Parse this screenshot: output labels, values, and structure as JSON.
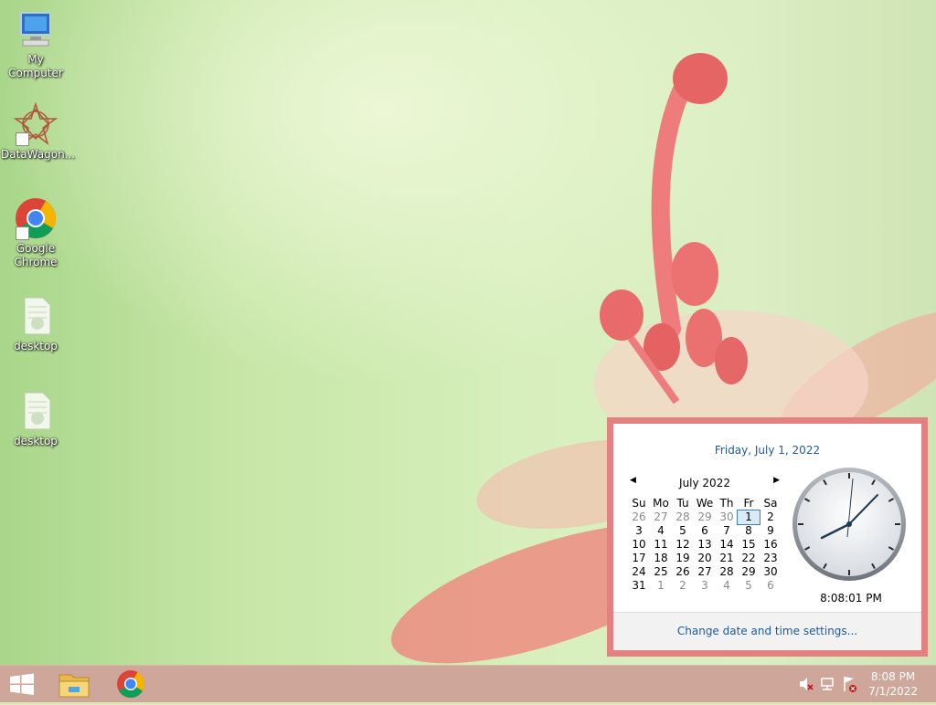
{
  "desktop": {
    "icons": [
      {
        "label": "My Computer",
        "icon": "my-computer-icon"
      },
      {
        "label": "DataWagon...",
        "icon": "datawagon-icon"
      },
      {
        "label": "Google Chrome",
        "icon": "chrome-icon"
      },
      {
        "label": "desktop",
        "icon": "file-icon"
      },
      {
        "label": "desktop",
        "icon": "file-icon"
      }
    ]
  },
  "taskbar": {
    "pinned": [
      {
        "name": "start-button",
        "icon": "windows-logo-icon"
      },
      {
        "name": "file-explorer",
        "icon": "folder-icon"
      },
      {
        "name": "google-chrome",
        "icon": "chrome-icon"
      }
    ],
    "tray_icons": [
      "volume-muted-icon",
      "network-icon",
      "action-center-flag-icon"
    ],
    "clock": {
      "time": "8:08 PM",
      "date": "7/1/2022"
    }
  },
  "calendar_popup": {
    "long_date": "Friday, July 1, 2022",
    "month_title": "July 2022",
    "weekdays": [
      "Su",
      "Mo",
      "Tu",
      "We",
      "Th",
      "Fr",
      "Sa"
    ],
    "weeks": [
      [
        {
          "d": "26",
          "o": true
        },
        {
          "d": "27",
          "o": true
        },
        {
          "d": "28",
          "o": true
        },
        {
          "d": "29",
          "o": true
        },
        {
          "d": "30",
          "o": true
        },
        {
          "d": "1",
          "t": true
        },
        {
          "d": "2"
        }
      ],
      [
        {
          "d": "3"
        },
        {
          "d": "4"
        },
        {
          "d": "5"
        },
        {
          "d": "6"
        },
        {
          "d": "7"
        },
        {
          "d": "8"
        },
        {
          "d": "9"
        }
      ],
      [
        {
          "d": "10"
        },
        {
          "d": "11"
        },
        {
          "d": "12"
        },
        {
          "d": "13"
        },
        {
          "d": "14"
        },
        {
          "d": "15"
        },
        {
          "d": "16"
        }
      ],
      [
        {
          "d": "17"
        },
        {
          "d": "18"
        },
        {
          "d": "19"
        },
        {
          "d": "20"
        },
        {
          "d": "21"
        },
        {
          "d": "22"
        },
        {
          "d": "23"
        }
      ],
      [
        {
          "d": "24"
        },
        {
          "d": "25"
        },
        {
          "d": "26"
        },
        {
          "d": "27"
        },
        {
          "d": "28"
        },
        {
          "d": "29"
        },
        {
          "d": "30"
        }
      ],
      [
        {
          "d": "31"
        },
        {
          "d": "1",
          "o": true
        },
        {
          "d": "2",
          "o": true
        },
        {
          "d": "3",
          "o": true
        },
        {
          "d": "4",
          "o": true
        },
        {
          "d": "5",
          "o": true
        },
        {
          "d": "6",
          "o": true
        }
      ]
    ],
    "clock_time": "8:08:01 PM",
    "settings_link": "Change date and time settings...",
    "accent_color": "#1e5a9c",
    "border_color": "#e38080"
  }
}
